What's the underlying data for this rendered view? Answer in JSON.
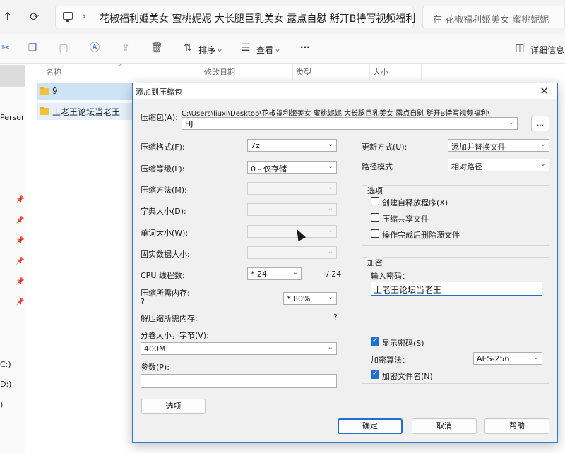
{
  "explorer": {
    "nav": {
      "back_glyph": "↑",
      "refresh_glyph": "⟳",
      "chevron": "›"
    },
    "address_path": "花椒福利姬美女 蜜桃妮妮 大长腿巨乳美女 露点自慰 掰开B特写视频福利",
    "search_placeholder": "在 花椒福利姬美女 蜜桃妮妮",
    "toolbar": {
      "sort_label": "排序",
      "view_label": "查看",
      "more_label": "···",
      "details_label": "详细信息"
    },
    "navpane": {
      "person_label": "Persor",
      "drives": [
        "C:)",
        "D:)",
        ")"
      ]
    },
    "columns": [
      "名称",
      "修改日期",
      "类型",
      "大小"
    ],
    "files": [
      {
        "name": "9"
      },
      {
        "name": "上老王论坛当老王"
      }
    ]
  },
  "dialog": {
    "title": "添加到压缩包",
    "archive_label": "压缩包(A):",
    "archive_path": "C:\\Users\\liuxi\\Desktop\\花椒福利姬美女 蜜桃妮妮 大长腿巨乳美女 露点自慰 掰开B特写视频福利\\",
    "archive_name": "HJ",
    "browse_label": "...",
    "left": {
      "format_label": "压缩格式(F):",
      "format_value": "7z",
      "level_label": "压缩等级(L):",
      "level_value": "0 - 仅存储",
      "method_label": "压缩方法(M):",
      "dict_label": "字典大小(D):",
      "word_label": "单词大小(W):",
      "solid_label": "固实数据大小:",
      "threads_label": "CPU 线程数:",
      "threads_value": "* 24",
      "threads_max": "/ 24",
      "mem_comp_label": "压缩所需内存:",
      "mem_comp_q": "?",
      "mem_comp_value": "* 80%",
      "mem_decomp_label": "解压缩所需内存:",
      "mem_decomp_q": "?",
      "split_label": "分卷大小，字节(V):",
      "split_value": "400M",
      "params_label": "参数(P):",
      "options_button": "选项"
    },
    "right": {
      "update_label": "更新方式(U):",
      "update_value": "添加并替换文件",
      "path_label": "路径模式",
      "path_value": "相对路径",
      "options_group": "选项",
      "sfx_label": "创建自释放程序(X)",
      "shared_label": "压缩共享文件",
      "delete_label": "操作完成后删除源文件",
      "encrypt_group": "加密",
      "password_label": "输入密码：",
      "password_value": "上老王论坛当老王",
      "show_pwd_label": "显示密码(S)",
      "method_label": "加密算法：",
      "method_value": "AES-256",
      "encrypt_names_label": "加密文件名(N)"
    },
    "buttons": {
      "ok": "确定",
      "cancel": "取消",
      "help": "帮助"
    }
  }
}
